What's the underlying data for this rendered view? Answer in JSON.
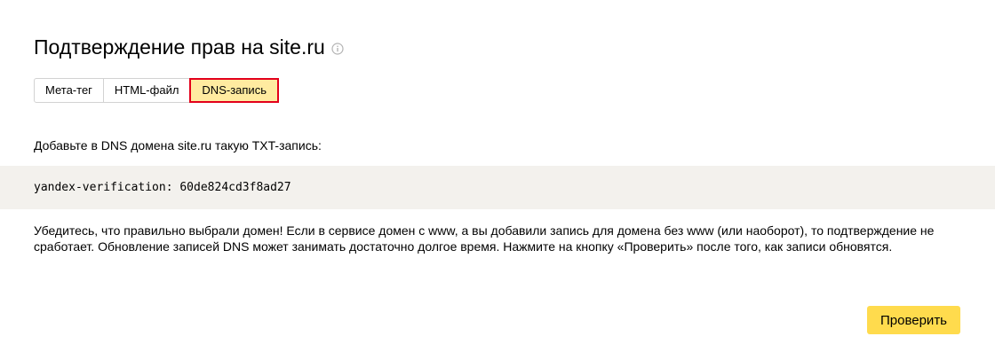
{
  "header": {
    "title": "Подтверждение прав на site.ru",
    "info_icon": "info-circle-icon"
  },
  "tabs": [
    {
      "label": "Мета-тег",
      "active": false
    },
    {
      "label": "HTML-файл",
      "active": false
    },
    {
      "label": "DNS-запись",
      "active": true
    }
  ],
  "content": {
    "intro": "Добавьте в DNS домена site.ru такую TXT-запись:",
    "record": "yandex-verification: 60de824cd3f8ad27",
    "warning": "Убедитесь, что правильно выбрали домен! Если в сервисе домен с www, а вы добавили запись для домена без www (или наоборот), то подтверждение не сработает. Обновление записей DNS может занимать достаточно долгое время. Нажмите на кнопку «Проверить» после того, как записи обновятся."
  },
  "actions": {
    "check_label": "Проверить"
  },
  "colors": {
    "active_tab_bg": "#ffeba0",
    "active_tab_border": "#e3001b",
    "record_bg": "#f3f1ed",
    "button_bg": "#ffdb4d"
  }
}
